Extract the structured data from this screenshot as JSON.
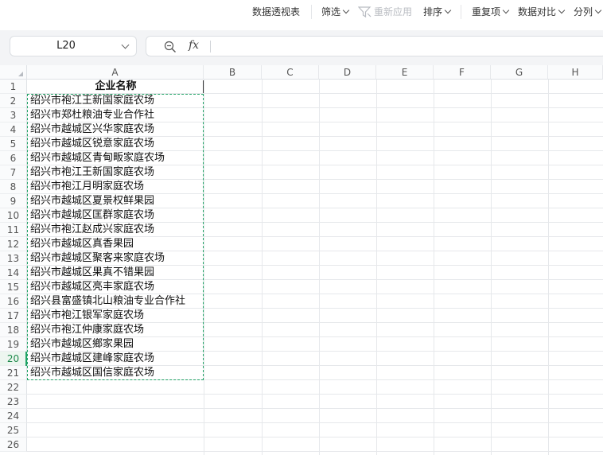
{
  "toolbar": {
    "items": [
      {
        "label": "数据透视表",
        "dropdown": false,
        "disabled": false
      },
      {
        "label": "筛选",
        "dropdown": true,
        "disabled": false
      },
      {
        "label": "重新应用",
        "dropdown": false,
        "disabled": true
      },
      {
        "label": "排序",
        "dropdown": true,
        "disabled": false
      },
      {
        "label": "重复项",
        "dropdown": true,
        "disabled": false
      },
      {
        "label": "数据对比",
        "dropdown": true,
        "disabled": false
      },
      {
        "label": "分列",
        "dropdown": true,
        "disabled": false
      }
    ]
  },
  "formula_bar": {
    "name_box": "L20",
    "fx_label": "fx",
    "formula": ""
  },
  "grid": {
    "columns": [
      "A",
      "B",
      "C",
      "D",
      "E",
      "F",
      "G",
      "H"
    ],
    "rows": [
      "1",
      "2",
      "3",
      "4",
      "5",
      "6",
      "7",
      "8",
      "9",
      "10",
      "11",
      "12",
      "13",
      "14",
      "15",
      "16",
      "17",
      "18",
      "19",
      "20",
      "21",
      "22",
      "23",
      "24",
      "25",
      "26"
    ],
    "active_row": "20",
    "header_cell": "企业名称",
    "column_a_values": [
      "绍兴市袍江王新国家庭农场",
      "绍兴市郑杜粮油专业合作社",
      "绍兴市越城区兴华家庭农场",
      "绍兴市越城区锐意家庭农场",
      "绍兴市越城区青甸畈家庭农场",
      "绍兴市袍江王新国家庭农场",
      "绍兴市袍江月明家庭农场",
      "绍兴市越城区夏景权鲜果园",
      "绍兴市越城区匡群家庭农场",
      "绍兴市袍江赵成兴家庭农场",
      "绍兴市越城区真香果园",
      "绍兴市越城区聚客来家庭农场",
      "绍兴市越城区果真不错果园",
      "绍兴市越城区亮丰家庭农场",
      "绍兴县富盛镇北山粮油专业合作社",
      "绍兴市袍江银军家庭农场",
      "绍兴市袍江仲康家庭农场",
      "绍兴市越城区鄉家果园",
      "绍兴市越城区建峰家庭农场",
      "绍兴市越城区国信家庭农场"
    ]
  },
  "colors": {
    "accent": "#21a366",
    "disabled_text": "#b9bcc2"
  }
}
